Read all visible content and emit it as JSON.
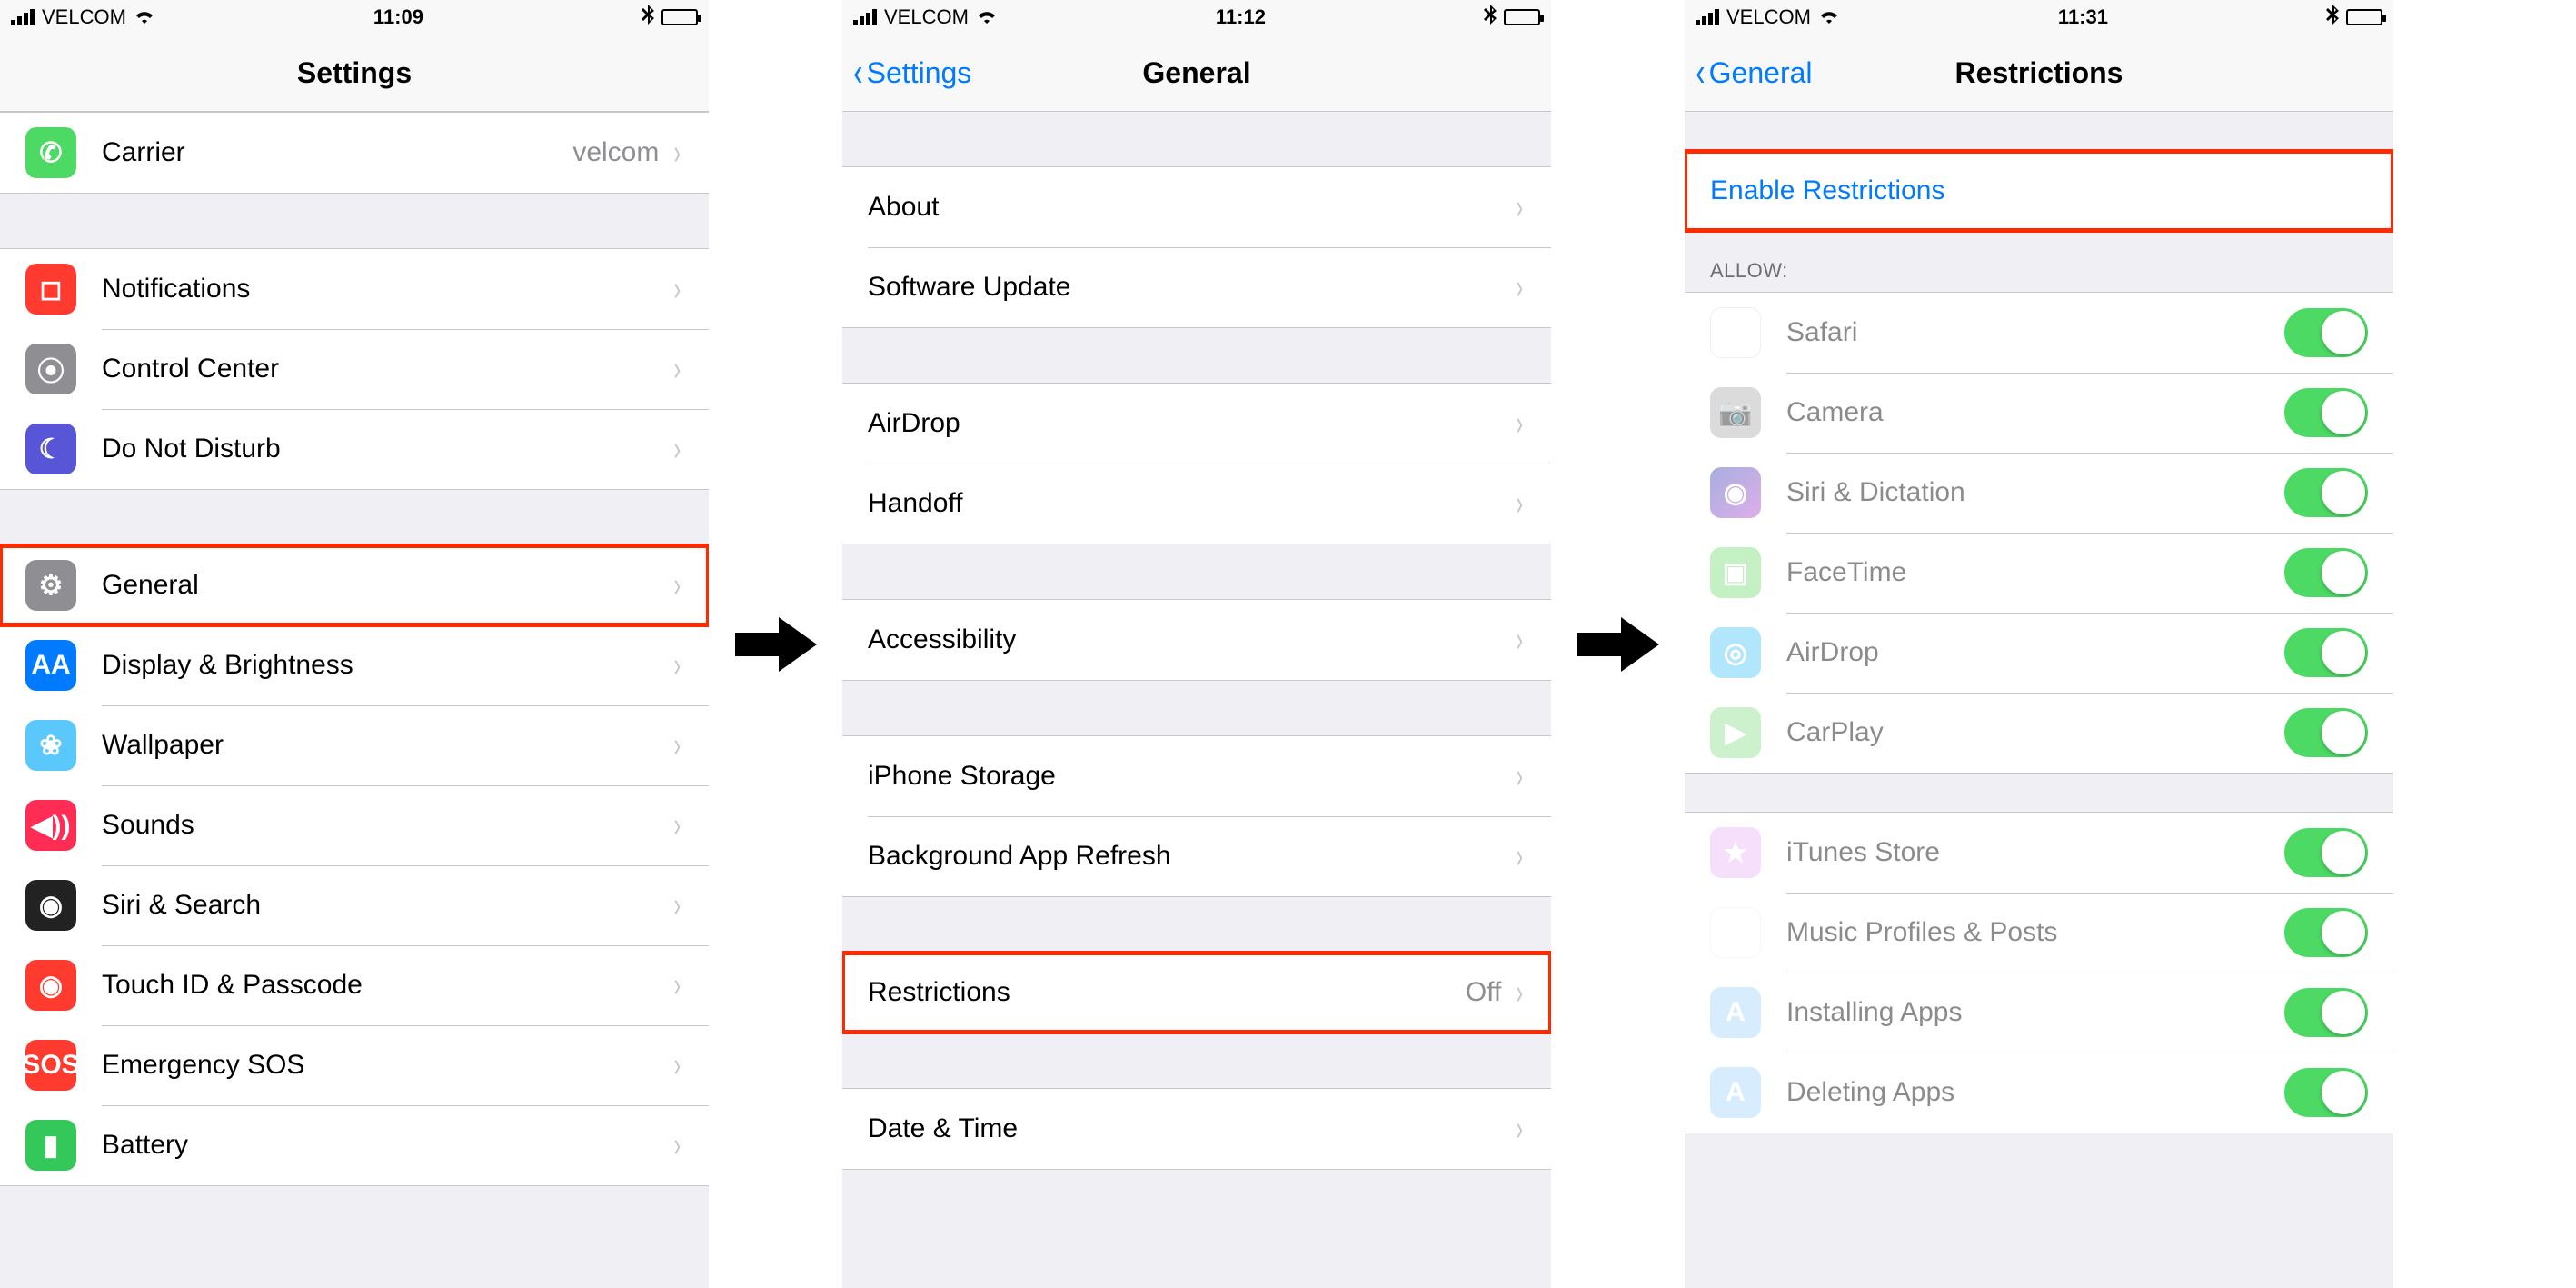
{
  "screens": {
    "s1": {
      "status": {
        "carrier": "VELCOM",
        "time": "11:09"
      },
      "title": "Settings",
      "groups": [
        {
          "cells": [
            {
              "k": "carrier",
              "label": "Carrier",
              "value": "velcom",
              "icon": "phone",
              "cls": "ic-green"
            }
          ]
        },
        {
          "cells": [
            {
              "k": "notifications",
              "label": "Notifications",
              "icon": "notif",
              "cls": "ic-red"
            },
            {
              "k": "control-center",
              "label": "Control Center",
              "icon": "cc",
              "cls": "ic-gray"
            },
            {
              "k": "dnd",
              "label": "Do Not Disturb",
              "icon": "moon",
              "cls": "ic-purple"
            }
          ]
        },
        {
          "cells": [
            {
              "k": "general",
              "label": "General",
              "icon": "gear",
              "cls": "ic-graygear",
              "highlight": true
            },
            {
              "k": "display",
              "label": "Display & Brightness",
              "icon": "aa",
              "cls": "ic-blue"
            },
            {
              "k": "wallpaper",
              "label": "Wallpaper",
              "icon": "flower",
              "cls": "ic-cyan"
            },
            {
              "k": "sounds",
              "label": "Sounds",
              "icon": "speaker",
              "cls": "ic-pink"
            },
            {
              "k": "siri",
              "label": "Siri & Search",
              "icon": "siri",
              "cls": "ic-black"
            },
            {
              "k": "touchid",
              "label": "Touch ID & Passcode",
              "icon": "finger",
              "cls": "ic-touchid"
            },
            {
              "k": "sos",
              "label": "Emergency SOS",
              "icon": "sos",
              "cls": "ic-sos"
            },
            {
              "k": "battery",
              "label": "Battery",
              "icon": "battery",
              "cls": "ic-battery"
            }
          ]
        }
      ]
    },
    "s2": {
      "status": {
        "carrier": "VELCOM",
        "time": "11:12"
      },
      "back": "Settings",
      "title": "General",
      "groups": [
        {
          "cells": [
            {
              "k": "about",
              "label": "About"
            },
            {
              "k": "swupdate",
              "label": "Software Update"
            }
          ]
        },
        {
          "cells": [
            {
              "k": "airdrop",
              "label": "AirDrop"
            },
            {
              "k": "handoff",
              "label": "Handoff"
            }
          ]
        },
        {
          "cells": [
            {
              "k": "accessibility",
              "label": "Accessibility"
            }
          ]
        },
        {
          "cells": [
            {
              "k": "storage",
              "label": "iPhone Storage"
            },
            {
              "k": "bgrefresh",
              "label": "Background App Refresh"
            }
          ]
        },
        {
          "cells": [
            {
              "k": "restrictions",
              "label": "Restrictions",
              "value": "Off",
              "highlight": true
            }
          ]
        },
        {
          "cells": [
            {
              "k": "datetime",
              "label": "Date & Time"
            }
          ]
        }
      ]
    },
    "s3": {
      "status": {
        "carrier": "VELCOM",
        "time": "11:31"
      },
      "back": "General",
      "title": "Restrictions",
      "enable_label": "Enable Restrictions",
      "allow_header": "ALLOW:",
      "allow": [
        {
          "k": "safari",
          "label": "Safari",
          "cls": "ic-safari",
          "glyph": "◎"
        },
        {
          "k": "camera",
          "label": "Camera",
          "cls": "ic-camera",
          "glyph": "📷"
        },
        {
          "k": "siridict",
          "label": "Siri & Dictation",
          "cls": "ic-siri",
          "glyph": "◉"
        },
        {
          "k": "facetime",
          "label": "FaceTime",
          "cls": "ic-facetime",
          "glyph": "▣"
        },
        {
          "k": "airdrop",
          "label": "AirDrop",
          "cls": "ic-airdrop",
          "glyph": "◎"
        },
        {
          "k": "carplay",
          "label": "CarPlay",
          "cls": "ic-carplay",
          "glyph": "▶"
        }
      ],
      "allow2": [
        {
          "k": "itunes",
          "label": "iTunes Store",
          "cls": "ic-itunes",
          "glyph": "★"
        },
        {
          "k": "music",
          "label": "Music Profiles & Posts",
          "cls": "ic-music",
          "glyph": "♪"
        },
        {
          "k": "install",
          "label": "Installing Apps",
          "cls": "ic-appstore",
          "glyph": "A"
        },
        {
          "k": "delete",
          "label": "Deleting Apps",
          "cls": "ic-appstore2",
          "glyph": "A"
        }
      ]
    }
  },
  "icon_glyphs": {
    "phone": "✆",
    "notif": "◻",
    "cc": "⦿",
    "moon": "☾",
    "gear": "⚙",
    "aa": "AA",
    "flower": "❀",
    "speaker": "◀))",
    "siri": "◉",
    "finger": "◉",
    "sos": "SOS",
    "battery": "▮"
  }
}
